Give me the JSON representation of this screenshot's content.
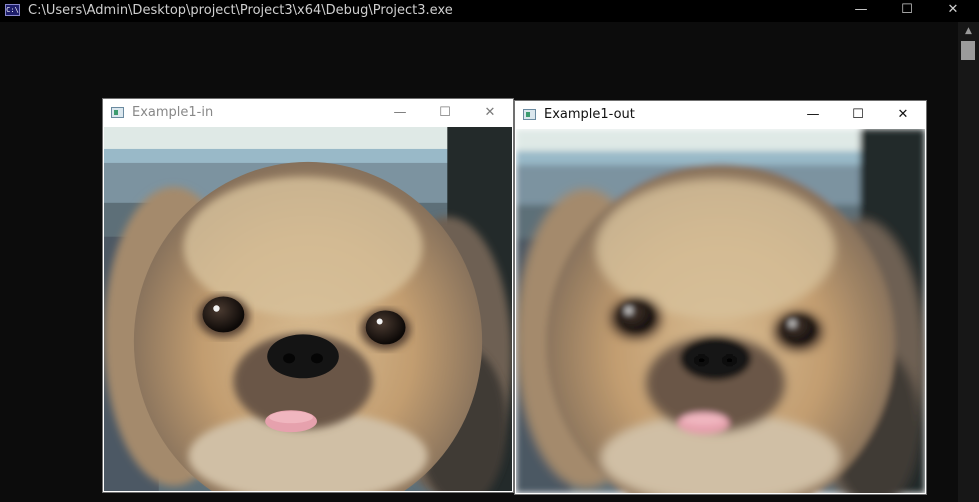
{
  "console": {
    "title": "C:\\Users\\Admin\\Desktop\\project\\Project3\\x64\\Debug\\Project3.exe",
    "icon_text": "C:\\",
    "icon": "console-app-icon",
    "buttons": {
      "minimize": "—",
      "maximize": "☐",
      "close": "✕"
    }
  },
  "windows": {
    "input": {
      "title": "Example1-in",
      "icon": "image-window-icon"
    },
    "output": {
      "title": "Example1-out",
      "icon": "image-window-icon"
    }
  },
  "window_buttons": {
    "minimize": "—",
    "maximize": "☐",
    "close": "✕"
  },
  "scrollbar": {
    "up_arrow": "▲"
  },
  "colors": {
    "console_bg": "#0c0c0c",
    "titlebar_bg": "#000000",
    "window_bg": "#ffffff"
  }
}
